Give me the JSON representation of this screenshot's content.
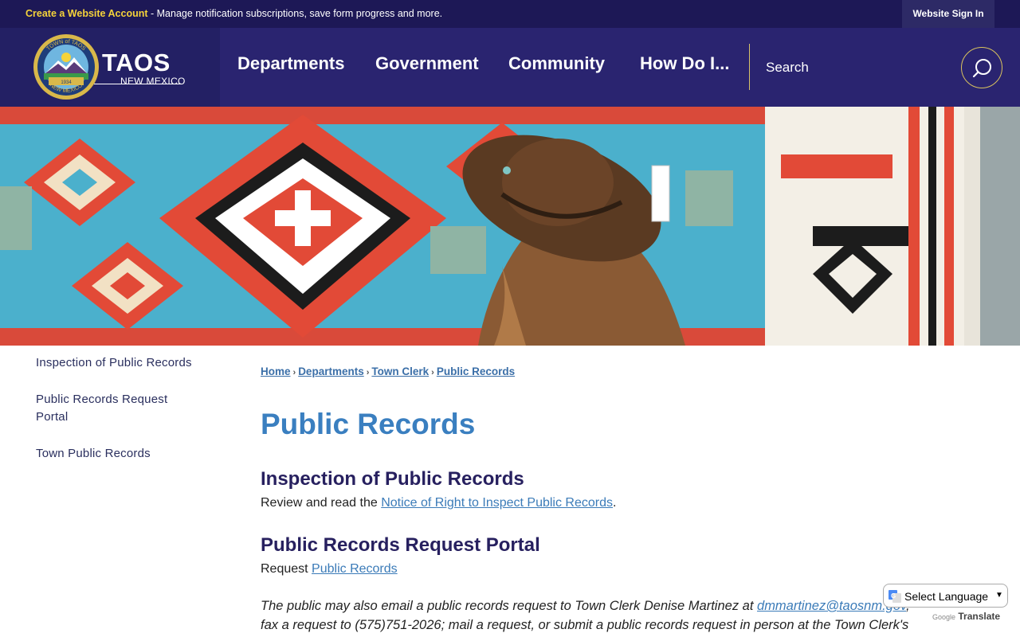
{
  "topbar": {
    "create_account": "Create a Website Account",
    "message": " - Manage notification subscriptions, save form progress and more.",
    "sign_in": "Website Sign In"
  },
  "logo": {
    "name": "TAOS",
    "subtitle": "NEW MEXICO",
    "seal_top": "TOWN of TAOS",
    "seal_year": "1934",
    "seal_bottom": "NEW MEXICO"
  },
  "nav": {
    "items": [
      "Departments",
      "Government",
      "Community",
      "How Do I..."
    ]
  },
  "search": {
    "placeholder": "Search"
  },
  "sidebar": {
    "items": [
      {
        "label": "Inspection of Public Records"
      },
      {
        "label_line1": "Public Records Request",
        "label_line2": "Portal"
      },
      {
        "label": "Town Public Records"
      }
    ]
  },
  "breadcrumb": [
    "Home",
    "Departments",
    "Town Clerk",
    "Public Records"
  ],
  "page": {
    "title": "Public Records",
    "section1": {
      "heading": "Inspection of Public Records",
      "text": "Review and read the ",
      "link": "Notice of Right to Inspect Public Records",
      "after": "."
    },
    "section2": {
      "heading": "Public Records Request Portal",
      "text": "Request ",
      "link": "Public Records"
    },
    "note": {
      "text1": "The public may also email a public records request to Town Clerk Denise Martinez at ",
      "email": "dmmartinez@taosnm.gov",
      "text2": ",",
      "text3": "fax a request to (575)751-2026; mail a request, or submit a public records request in person at the Town Clerk's"
    }
  },
  "translate": {
    "label": "Select Language",
    "powered_by": "Google",
    "translate": "Translate"
  },
  "colors": {
    "topbar": "#1d1856",
    "header": "#2a2470",
    "accent_gold": "#f5d33a",
    "title_blue": "#3a7fc0",
    "heading_navy": "#27205f",
    "link_blue": "#3b7bb8"
  }
}
